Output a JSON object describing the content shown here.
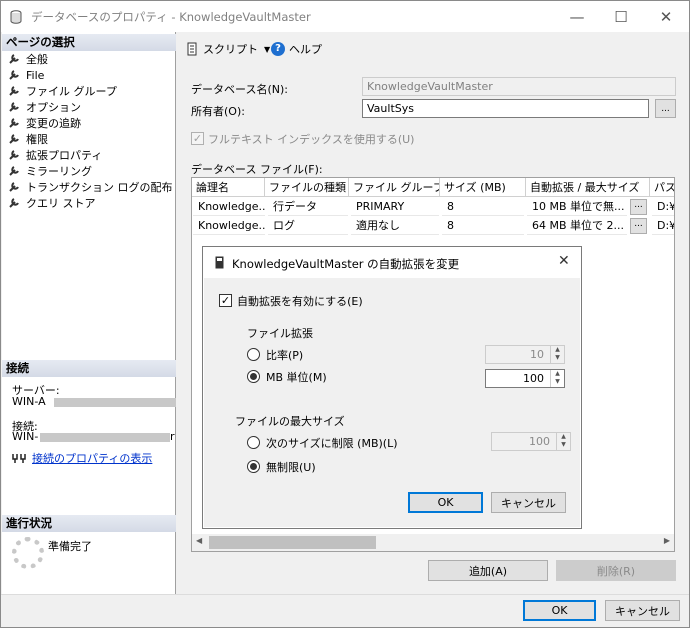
{
  "window": {
    "title": "データベースのプロパティ - KnowledgeVaultMaster",
    "minimize": "—",
    "maximize": "☐",
    "close": "✕"
  },
  "left_panel": {
    "select_page_header": "ページの選択",
    "pages": [
      "全般",
      "File",
      "ファイル グループ",
      "オプション",
      "変更の追跡",
      "権限",
      "拡張プロパティ",
      "ミラーリング",
      "トランザクション ログの配布",
      "クエリ ストア"
    ],
    "connection_header": "接続",
    "server_label": "サーバー:",
    "server_value": "WIN-A",
    "connection_label": "接続:",
    "connection_value": "WIN-",
    "connection_value_suffix": "r",
    "connection_properties_link": "接続のプロパティの表示",
    "progress_header": "進行状況",
    "progress_status": "準備完了"
  },
  "toolbar": {
    "script_label": "スクリプト",
    "help_label": "ヘルプ"
  },
  "form": {
    "db_name_label": "データベース名(N):",
    "db_name_value": "KnowledgeVaultMaster",
    "owner_label": "所有者(O):",
    "owner_value": "VaultSys",
    "owner_browse": "...",
    "fulltext_label": "フルテキスト インデックスを使用する(U)",
    "db_files_label": "データベース ファイル(F):"
  },
  "grid": {
    "columns": [
      "論理名",
      "ファイルの種類",
      "ファイル グループ",
      "サイズ (MB)",
      "自動拡張 / 最大サイズ",
      "パス"
    ],
    "rows": [
      [
        "Knowledge...",
        "行データ",
        "PRIMARY",
        "8",
        "10 MB 単位で無...",
        "D:¥P"
      ],
      [
        "Knowledge...",
        "ログ",
        "適用なし",
        "8",
        "64 MB 単位で 2...",
        "D:¥P"
      ]
    ],
    "ellipsis": "..."
  },
  "buttons": {
    "add": "追加(A)",
    "remove": "削除(R)",
    "ok": "OK",
    "cancel": "キャンセル"
  },
  "dialog": {
    "title": "KnowledgeVaultMaster の自動拡張を変更",
    "close": "✕",
    "enable_autogrow": "自動拡張を有効にする(E)",
    "file_growth_label": "ファイル拡張",
    "percent_label": "比率(P)",
    "percent_value": "10",
    "mb_label": "MB 単位(M)",
    "mb_value": "100",
    "max_size_label": "ファイルの最大サイズ",
    "limited_label": "次のサイズに制限 (MB)(L)",
    "limited_value": "100",
    "unlimited_label": "無制限(U)",
    "ok": "OK",
    "cancel": "キャンセル"
  },
  "colors": {
    "link": "#0033cc",
    "default_button_border": "#0078d7"
  }
}
